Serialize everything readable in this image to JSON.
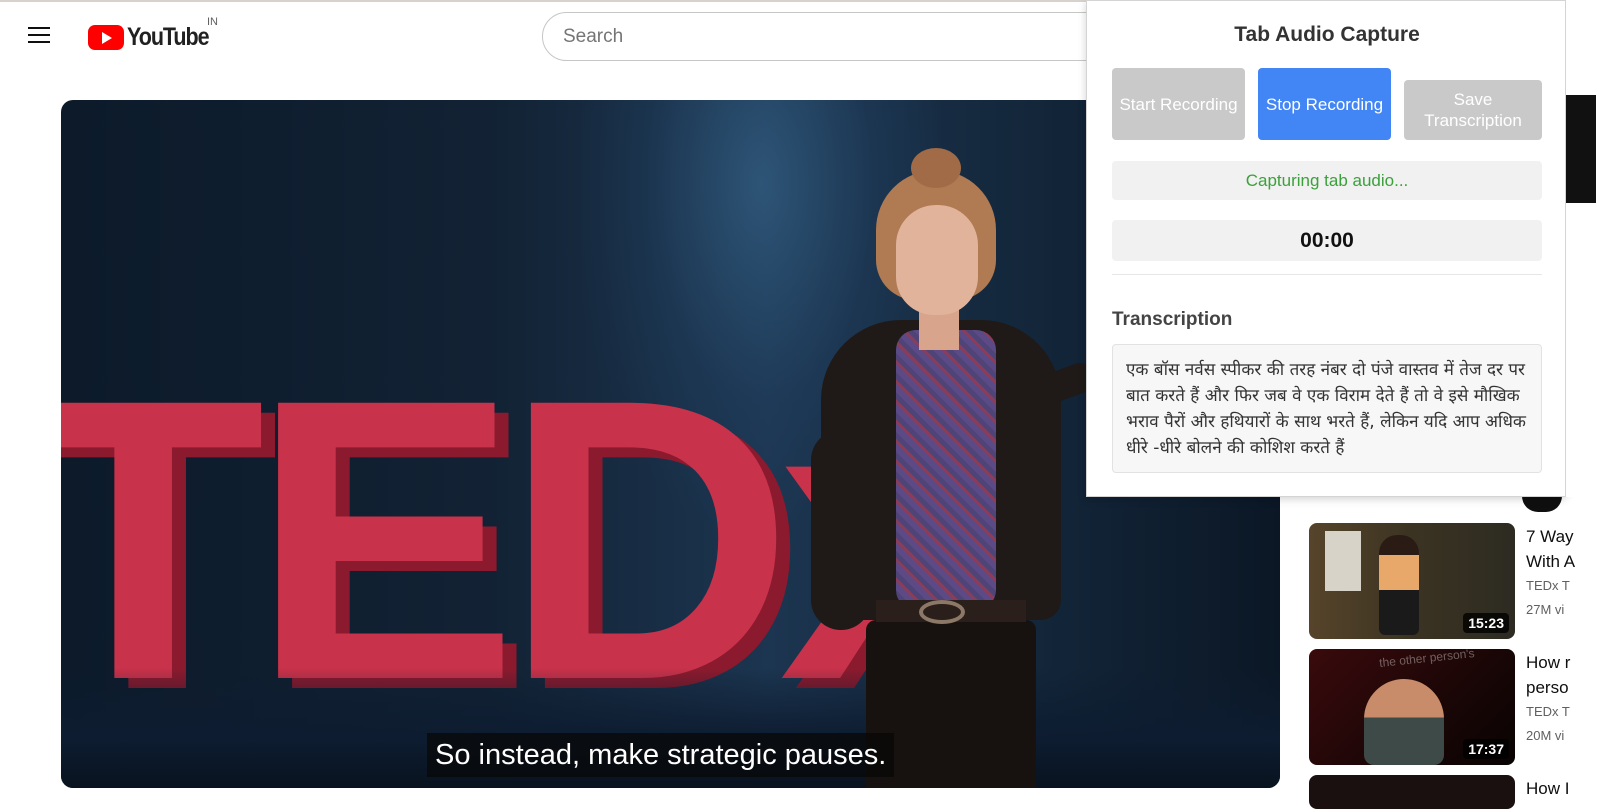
{
  "header": {
    "logo_text": "YouTube",
    "country_code": "IN",
    "search_placeholder": "Search"
  },
  "player": {
    "caption": "So instead, make strategic pauses."
  },
  "recommendations": [
    {
      "title": "7 Way",
      "title_line2": "With A",
      "channel": "TEDx T",
      "views": "27M vi",
      "duration": "15:23"
    },
    {
      "title": "How r",
      "title_line2": "perso",
      "channel": "TEDx T",
      "views": "20M vi",
      "duration": "17:37",
      "overlay": "the other person's"
    },
    {
      "title": "How I"
    }
  ],
  "extension": {
    "title": "Tab Audio Capture",
    "start_label": "Start Recording",
    "stop_label": "Stop Recording",
    "save_label": "Save Transcription",
    "status_text": "Capturing tab audio...",
    "timer": "00:00",
    "transcription_label": "Transcription",
    "transcription_text": "एक बॉस नर्वस स्पीकर की तरह नंबर दो पंजे वास्तव में तेज दर पर बात करते हैं और फिर जब वे एक विराम देते हैं तो वे इसे मौखिक भराव पैरों और हथियारों के साथ भरते हैं, लेकिन यदि आप अधिक धीरे -धीरे बोलने की कोशिश करते हैं"
  },
  "colors": {
    "stop_button": "#4285f4",
    "disabled_button": "#c9c9c9",
    "status_text": "#3ba13b",
    "youtube_red": "#ff0000"
  }
}
